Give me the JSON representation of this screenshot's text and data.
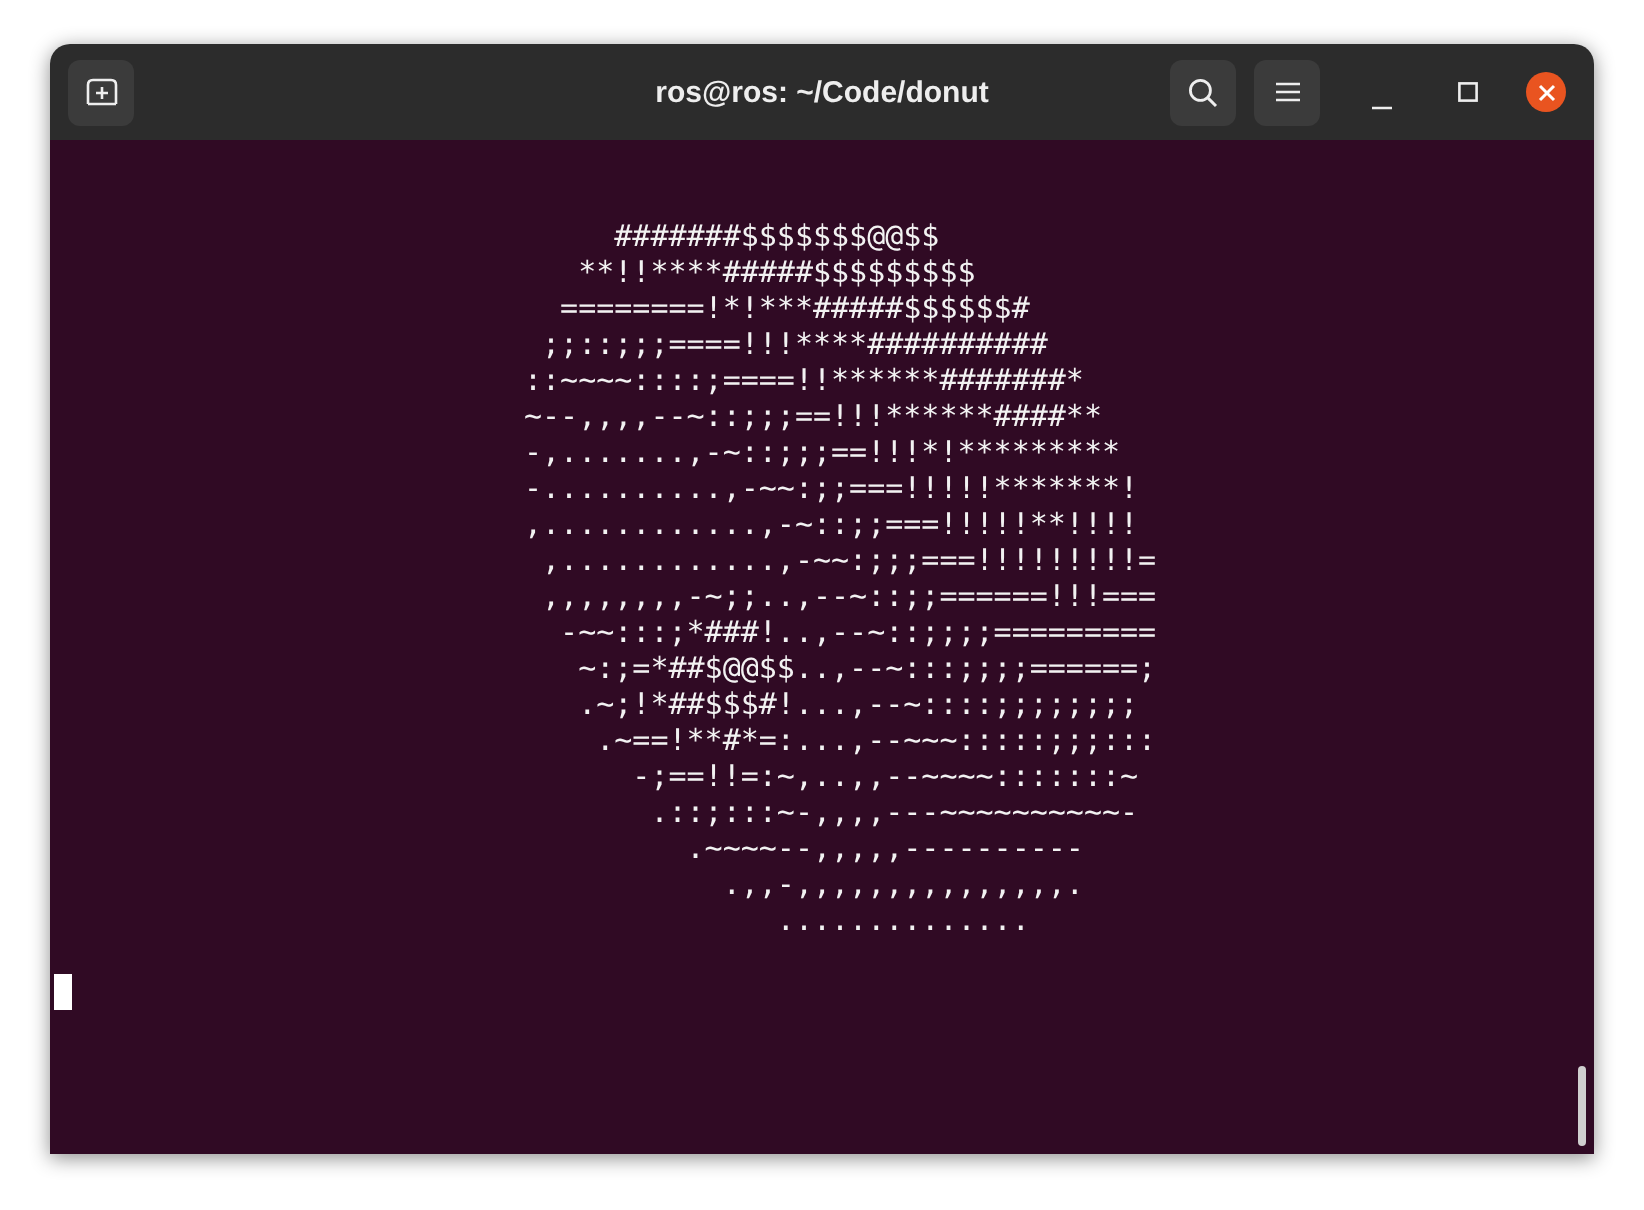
{
  "window": {
    "title": "ros@ros: ~/Code/donut"
  },
  "terminal": {
    "lines": [
      "     #######$$$$$$$@@$$",
      "   **!!****#####$$$$$$$$$",
      "  ========!*!***#####$$$$$$#",
      " ;;::;;;====!!!****##########",
      "::~~~~::::;====!!******#######*",
      "~--,,,,--~::;;;==!!!******####**",
      "-,.......,-~::;;;==!!!*!*********",
      "-..........,-~~:;;===!!!!!*******!",
      ",............,-~::;;===!!!!!**!!!!",
      " ,............,-~~:;;;===!!!!!!!!!=",
      " ,,,,,,,,-~;;..,--~::;;======!!!===",
      "  -~~:::;*###!..,--~::;;;;=========",
      "   ~:;=*##$@@$$..,--~:::;;;;======;",
      "   .~;!*##$$$#!...,--~::::;;;;;;;;",
      "    .~==!**#*=:...,--~~~:::::;;;:::",
      "      -;==!!=:~,..,,--~~~~:::::::~",
      "       .::;:::~-,,,,---~~~~~~~~~~-",
      "         .~~~~--,,,,,----------",
      "           .,,-,,,,,,,,,,,,,,,.",
      "              .............."
    ],
    "cursor_visible": true
  }
}
